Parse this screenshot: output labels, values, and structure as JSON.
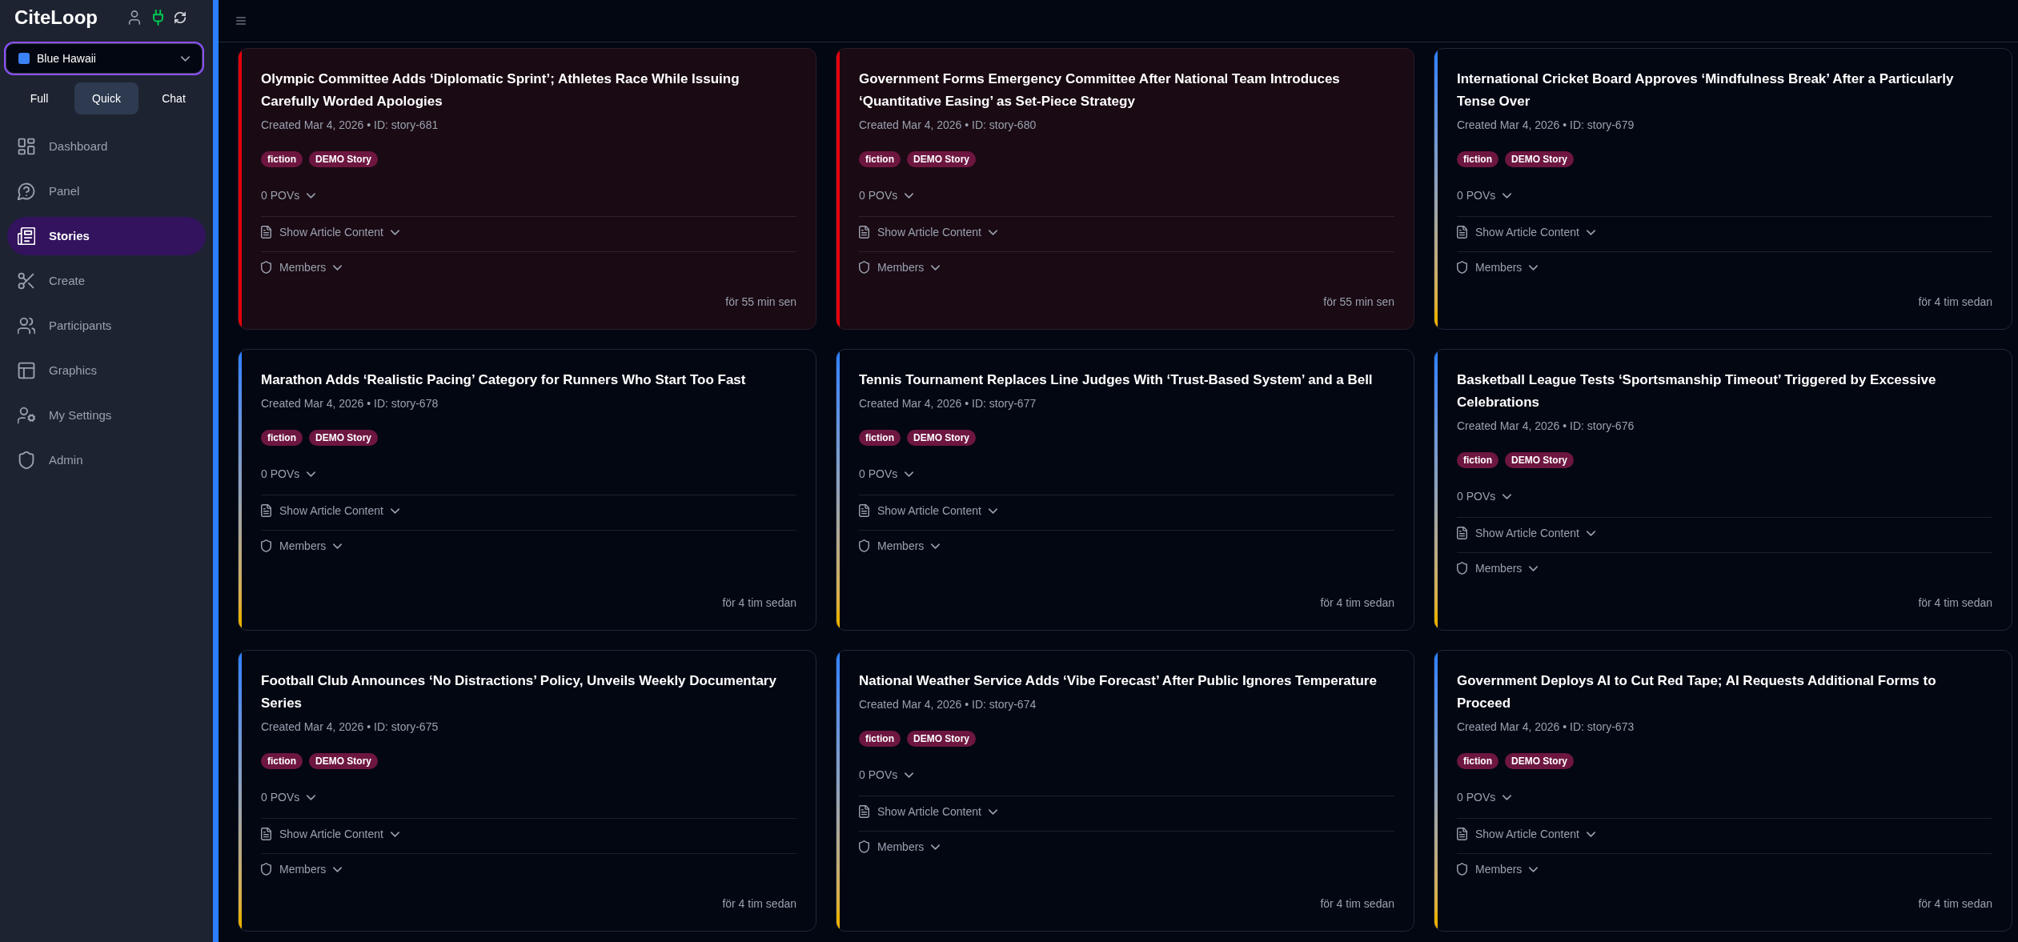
{
  "sidebar": {
    "logo": "CiteLoop",
    "connection": {
      "connected": true
    },
    "workspace": {
      "value": "Blue Hawaii",
      "color": "#3b82f6"
    },
    "modes": [
      {
        "label": "Full",
        "selected": false
      },
      {
        "label": "Quick",
        "selected": true
      },
      {
        "label": "Chat",
        "selected": false
      }
    ],
    "nav": [
      {
        "label": "Dashboard",
        "selected": false
      },
      {
        "label": "Panel",
        "selected": false
      },
      {
        "label": "Stories",
        "selected": true
      },
      {
        "label": "Create",
        "selected": false
      },
      {
        "label": "Participants",
        "selected": false
      },
      {
        "label": "Graphics",
        "selected": false
      },
      {
        "label": "My Settings",
        "selected": false
      },
      {
        "label": "Admin",
        "selected": false
      }
    ]
  },
  "stories": [
    {
      "title": "Olympic Committee Adds ‘Diplomatic Sprint’; Athletes Race While Issuing Carefully Worded Apologies",
      "meta": "Created Mar 4, 2026 • ID: story-681",
      "tags": [
        "fiction",
        "DEMO Story"
      ],
      "povs": "0 POVs",
      "article_toggle": "Show Article Content",
      "members_toggle": "Members",
      "time": "för 55 min sen",
      "highlighted": true
    },
    {
      "title": "Government Forms Emergency Committee After National Team Introduces ‘Quantitative Easing’ as Set-Piece Strategy",
      "meta": "Created Mar 4, 2026 • ID: story-680",
      "tags": [
        "fiction",
        "DEMO Story"
      ],
      "povs": "0 POVs",
      "article_toggle": "Show Article Content",
      "members_toggle": "Members",
      "time": "för 55 min sen",
      "highlighted": true
    },
    {
      "title": "International Cricket Board Approves ‘Mindfulness Break’ After a Particularly Tense Over",
      "meta": "Created Mar 4, 2026 • ID: story-679",
      "tags": [
        "fiction",
        "DEMO Story"
      ],
      "povs": "0 POVs",
      "article_toggle": "Show Article Content",
      "members_toggle": "Members",
      "time": "för 4 tim sedan",
      "highlighted": false
    },
    {
      "title": "Marathon Adds ‘Realistic Pacing’ Category for Runners Who Start Too Fast",
      "meta": "Created Mar 4, 2026 • ID: story-678",
      "tags": [
        "fiction",
        "DEMO Story"
      ],
      "povs": "0 POVs",
      "article_toggle": "Show Article Content",
      "members_toggle": "Members",
      "time": "för 4 tim sedan",
      "highlighted": false
    },
    {
      "title": "Tennis Tournament Replaces Line Judges With ‘Trust-Based System’ and a Bell",
      "meta": "Created Mar 4, 2026 • ID: story-677",
      "tags": [
        "fiction",
        "DEMO Story"
      ],
      "povs": "0 POVs",
      "article_toggle": "Show Article Content",
      "members_toggle": "Members",
      "time": "för 4 tim sedan",
      "highlighted": false
    },
    {
      "title": "Basketball League Tests ‘Sportsmanship Timeout’ Triggered by Excessive Celebrations",
      "meta": "Created Mar 4, 2026 • ID: story-676",
      "tags": [
        "fiction",
        "DEMO Story"
      ],
      "povs": "0 POVs",
      "article_toggle": "Show Article Content",
      "members_toggle": "Members",
      "time": "för 4 tim sedan",
      "highlighted": false
    },
    {
      "title": "Football Club Announces ‘No Distractions’ Policy, Unveils Weekly Documentary Series",
      "meta": "Created Mar 4, 2026 • ID: story-675",
      "tags": [
        "fiction",
        "DEMO Story"
      ],
      "povs": "0 POVs",
      "article_toggle": "Show Article Content",
      "members_toggle": "Members",
      "time": "för 4 tim sedan",
      "highlighted": false
    },
    {
      "title": "National Weather Service Adds ‘Vibe Forecast’ After Public Ignores Temperature",
      "meta": "Created Mar 4, 2026 • ID: story-674",
      "tags": [
        "fiction",
        "DEMO Story"
      ],
      "povs": "0 POVs",
      "article_toggle": "Show Article Content",
      "members_toggle": "Members",
      "time": "för 4 tim sedan",
      "highlighted": false
    },
    {
      "title": "Government Deploys AI to Cut Red Tape; AI Requests Additional Forms to Proceed",
      "meta": "Created Mar 4, 2026 • ID: story-673",
      "tags": [
        "fiction",
        "DEMO Story"
      ],
      "povs": "0 POVs",
      "article_toggle": "Show Article Content",
      "members_toggle": "Members",
      "time": "för 4 tim sedan",
      "highlighted": false
    }
  ]
}
